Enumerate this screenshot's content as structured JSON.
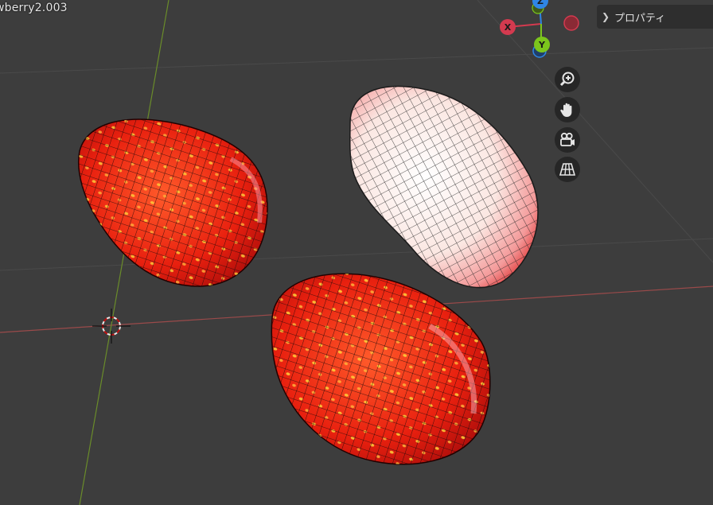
{
  "viewport": {
    "object_name": "wberry2.003",
    "background_color": "#3d3d3d",
    "x_axis_color": "#9a4a4a",
    "y_axis_color": "#6a8c2a"
  },
  "properties_panel": {
    "label": "プロパティ",
    "chevron_icon": "chevron-right-icon"
  },
  "axis_gizmo": {
    "x_label": "X",
    "y_label": "Y",
    "z_label": "Z",
    "x_color": "#d33a4f",
    "y_color": "#7cc61c",
    "z_color": "#2f86e6"
  },
  "nav_buttons": [
    {
      "icon": "zoom-icon",
      "tooltip_name": "zoom"
    },
    {
      "icon": "hand-pan-icon",
      "tooltip_name": "pan"
    },
    {
      "icon": "camera-view-icon",
      "tooltip_name": "camera"
    },
    {
      "icon": "grid-view-icon",
      "tooltip_name": "orthographic"
    }
  ],
  "objects": [
    {
      "name": "strawberry-left",
      "state": "textured"
    },
    {
      "name": "strawberry-top-right",
      "state": "selected-light"
    },
    {
      "name": "strawberry-bottom",
      "state": "textured"
    }
  ]
}
